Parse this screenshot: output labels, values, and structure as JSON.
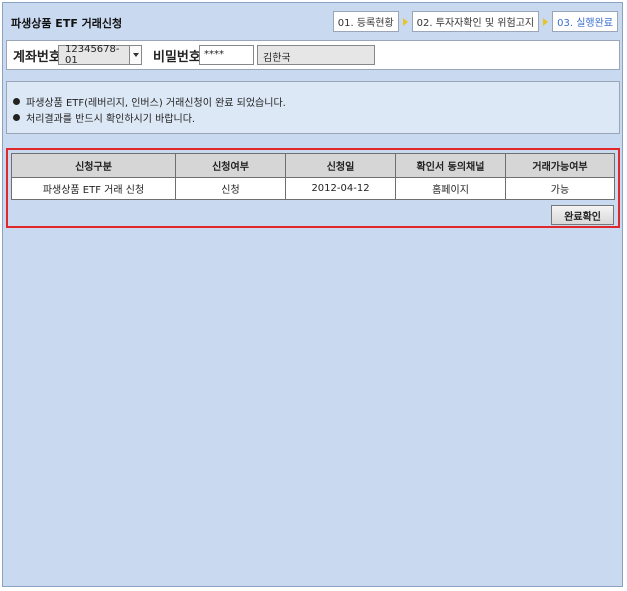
{
  "page": {
    "title": "파생상품 ETF 거래신청"
  },
  "steps": [
    "01. 등록현황",
    "02. 투자자확인 및 위험고지",
    "03. 실행완료"
  ],
  "account": {
    "label": "계좌번호",
    "number": "12345678-01",
    "password_label": "비밀번호",
    "password": "****",
    "holder": "김한국"
  },
  "notice": [
    "파생상품 ETF(레버리지, 인버스) 거래신청이 완료 되었습니다.",
    "처리결과를 반드시 확인하시기 바랍니다."
  ],
  "table": {
    "headers": [
      "신청구분",
      "신청여부",
      "신청일",
      "확인서 동의채널",
      "거래가능여부"
    ],
    "rows": [
      [
        "파생상품 ETF 거래 신청",
        "신청",
        "2012-04-12",
        "홈페이지",
        "가능"
      ]
    ]
  },
  "confirm_label": "완료확인",
  "colors": {
    "background": "#c8d9f0",
    "highlight_border": "#e0272b",
    "active_step": "#3a6fd0",
    "step_arrow": "#e7c52a"
  }
}
